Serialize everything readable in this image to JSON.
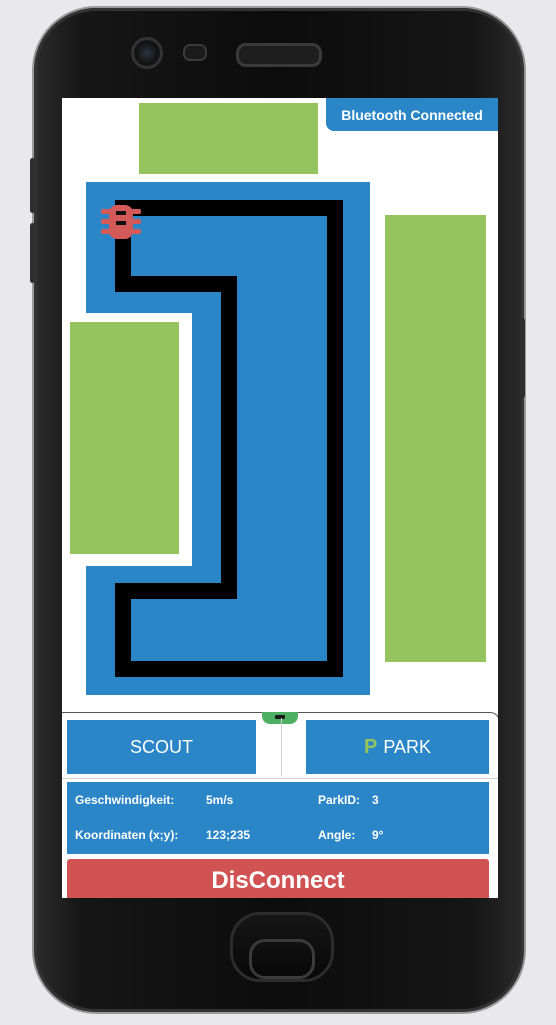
{
  "status": {
    "bluetooth": "Bluetooth Connected"
  },
  "controls": {
    "scout_label": "SCOUT",
    "park_icon": "P",
    "park_label": "PARK",
    "disconnect_label": "DisConnect"
  },
  "telemetry": {
    "speed_label": "Geschwindigkeit:",
    "speed_value": "5m/s",
    "coords_label": "Koordinaten (x;y):",
    "coords_value": "123;235",
    "parkid_label": "ParkID:",
    "parkid_value": "3",
    "angle_label": "Angle:",
    "angle_value": "9°"
  },
  "colors": {
    "accent_blue": "#2b86c7",
    "parking_green": "#95c35e",
    "danger_red": "#d05252",
    "car_red": "#d45a5a",
    "handle_green": "#4caf62"
  },
  "icons": [
    "car-icon",
    "park-p-icon",
    "drawer-handle-icon"
  ]
}
